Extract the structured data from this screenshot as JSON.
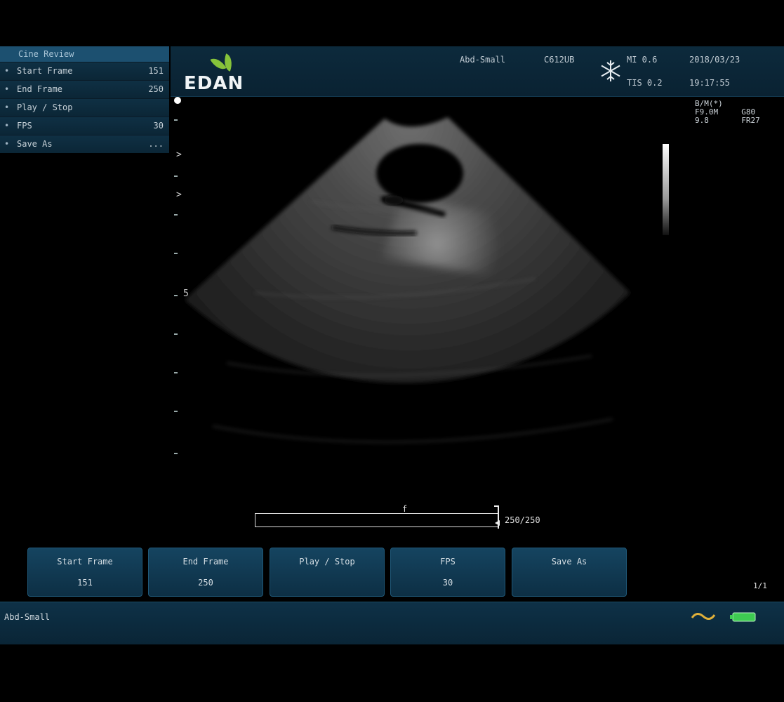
{
  "brand": {
    "logo_text": "EDAN"
  },
  "header": {
    "preset": "Abd-Small",
    "probe": "C612UB",
    "mi": "MI 0.6",
    "tis": "TIS 0.2",
    "date": "2018/03/23",
    "time": "19:17:55"
  },
  "cine_panel": {
    "title": "Cine Review",
    "items": [
      {
        "label": "Start Frame",
        "value": "151"
      },
      {
        "label": "End Frame",
        "value": "250"
      },
      {
        "label": "Play / Stop",
        "value": ""
      },
      {
        "label": "FPS",
        "value": "30"
      },
      {
        "label": "Save As",
        "value": "..."
      }
    ]
  },
  "image_info": {
    "lines": [
      "B/M(*)",
      "F9.0M     G80",
      "9.8       FR27"
    ]
  },
  "depth_scale": {
    "labels": [
      ">",
      ">",
      "5"
    ]
  },
  "cine_progress": {
    "current": 250,
    "total": 250,
    "count_text": "250/250",
    "start_marker": "f"
  },
  "soft_buttons": [
    {
      "label": "Start Frame",
      "value": "151"
    },
    {
      "label": "End Frame",
      "value": "250"
    },
    {
      "label": "Play / Stop",
      "value": ""
    },
    {
      "label": "FPS",
      "value": "30"
    },
    {
      "label": "Save As",
      "value": ""
    }
  ],
  "page_indicator": "1/1",
  "status_bar": {
    "mode": "Abd-Small"
  },
  "icons": {
    "freeze": "snowflake-icon",
    "wave": "wave-icon",
    "battery": "battery-icon"
  },
  "colors": {
    "panel": "#0c2535",
    "accent": "#1c5070",
    "leaf": "#86c33a",
    "wave": "#e0b03a",
    "battery": "#3ecb52"
  }
}
